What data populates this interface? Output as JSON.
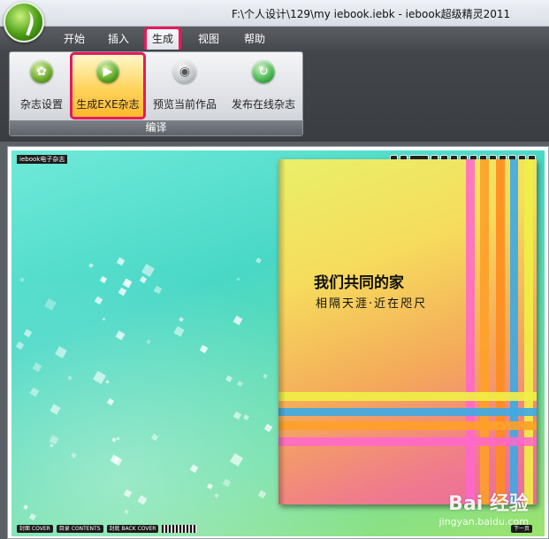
{
  "window": {
    "title": "F:\\个人设计\\129\\my iebook.iebk - iebook超级精灵2011"
  },
  "menu": {
    "items": [
      "开始",
      "插入",
      "生成",
      "视图",
      "帮助"
    ],
    "active": "生成"
  },
  "ribbon": {
    "group_label": "编译",
    "buttons": [
      {
        "label": "杂志设置",
        "icon": "gear-icon"
      },
      {
        "label": "生成EXE杂志",
        "icon": "play-icon"
      },
      {
        "label": "预览当前作品",
        "icon": "preview-icon"
      },
      {
        "label": "发布在线杂志",
        "icon": "publish-icon"
      }
    ]
  },
  "viewer": {
    "brand": "iebook电子杂志",
    "bottom_buttons": [
      "封面 COVER",
      "目录 CONTENTS",
      "封底 BACK COVER"
    ],
    "next_label": "下一页",
    "book": {
      "title": "我们共同的家",
      "subtitle": "相隔天涯·近在咫尺"
    }
  },
  "watermark": {
    "main": "Bai 经验",
    "sub": "jingyan.baidu.com"
  },
  "colors": {
    "highlight": "#e8195a",
    "menubar": "#4b4e53"
  }
}
